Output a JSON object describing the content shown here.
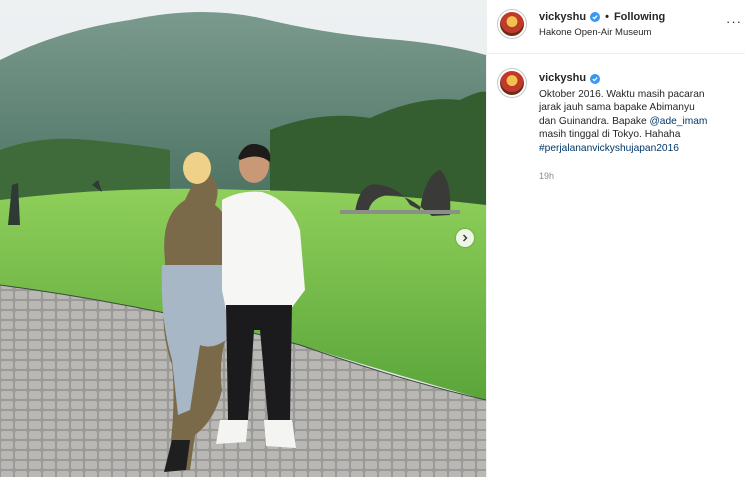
{
  "post": {
    "username": "vickyshu",
    "dot": "•",
    "follow_state": "Following",
    "location": "Hakone Open-Air Museum",
    "more_label": "···"
  },
  "caption": {
    "username": "vickyshu",
    "lines": [
      "Oktober 2016. Waktu masih pacaran",
      "jarak jauh sama bapake Abimanyu",
      "dan Guinandra. Bapake "
    ],
    "mention": "@ade_imam",
    "line_after_mention": "masih tinggal di Tokyo. Hahaha",
    "hashtag": "#perjalananvickyshujapan2016",
    "time": "19h"
  },
  "icons": {
    "verified": "verified-badge-icon",
    "next": "chevron-right-icon",
    "more": "more-options-icon"
  },
  "colors": {
    "verified": "#3897f0",
    "link": "#00376b",
    "muted": "#8e8e8e"
  }
}
